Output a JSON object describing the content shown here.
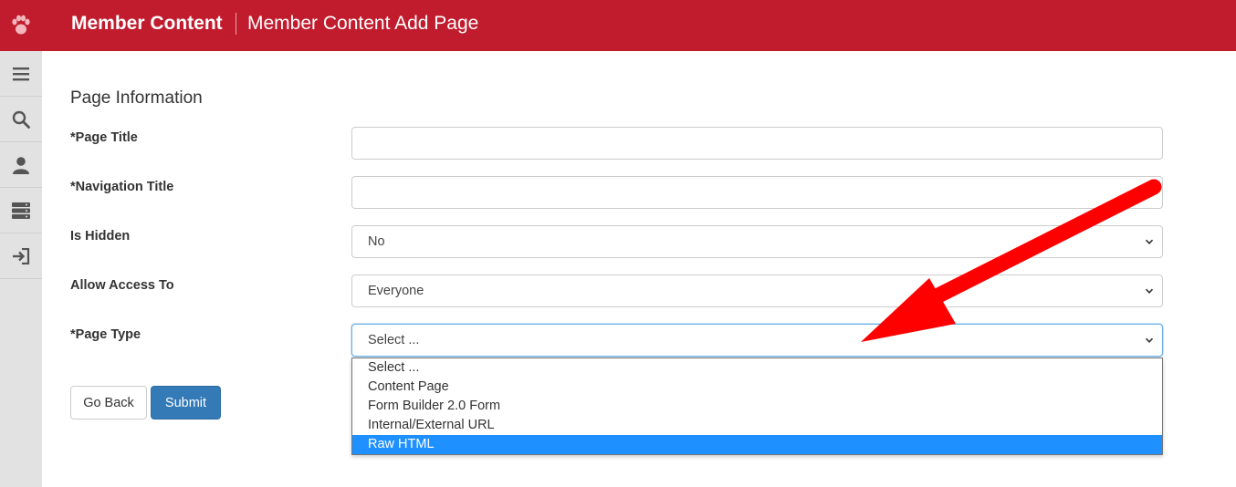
{
  "header": {
    "title": "Member Content",
    "subtitle": "Member Content Add Page",
    "logo_icon": "paw-icon",
    "bg_color": "#c01c2e"
  },
  "sidebar": {
    "items": [
      {
        "icon": "hamburger-menu-icon"
      },
      {
        "icon": "search-icon"
      },
      {
        "icon": "user-icon"
      },
      {
        "icon": "server-icon"
      },
      {
        "icon": "sign-out-icon"
      }
    ]
  },
  "form": {
    "section_title": "Page Information",
    "page_title": {
      "label": "*Page Title",
      "value": ""
    },
    "navigation_title": {
      "label": "*Navigation Title",
      "value": ""
    },
    "is_hidden": {
      "label": "Is Hidden",
      "value": "No"
    },
    "allow_access": {
      "label": "Allow Access To",
      "value": "Everyone"
    },
    "page_type": {
      "label": "*Page Type",
      "value": "Select ...",
      "options": [
        "Select ...",
        "Content Page",
        "Form Builder 2.0 Form",
        "Internal/External URL",
        "Raw HTML"
      ],
      "highlighted": "Raw HTML"
    }
  },
  "buttons": {
    "back": "Go Back",
    "submit": "Submit"
  },
  "annotation": {
    "type": "arrow",
    "color": "#ff0000"
  }
}
